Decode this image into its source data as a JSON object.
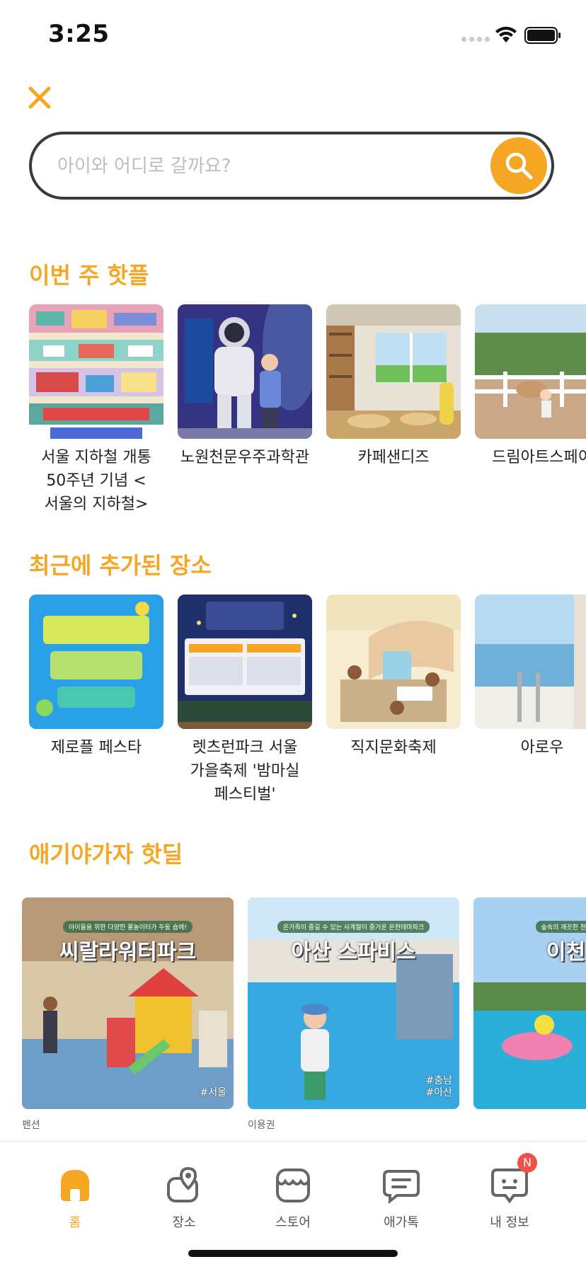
{
  "status_bar": {
    "time": "3:25"
  },
  "search": {
    "placeholder": "아이와 어디로 갈까요?"
  },
  "colors": {
    "accent": "#f5a623",
    "badge": "#f0524a"
  },
  "sections": {
    "hot_places": {
      "title": "이번 주 핫플",
      "items": [
        {
          "name": "서울 지하철 개통 50주년 기념 <서울의 지하철>"
        },
        {
          "name": "노원천문우주과학관"
        },
        {
          "name": "카페샌디즈"
        },
        {
          "name": "드림아트스페이"
        }
      ]
    },
    "recent_places": {
      "title": "최근에 추가된 장소",
      "items": [
        {
          "name": "제로플 페스타"
        },
        {
          "name": "렛츠런파크 서울 가을축제 '밤마실 페스티벌'"
        },
        {
          "name": "직지문화축제"
        },
        {
          "name": "아로우"
        }
      ]
    },
    "hot_deals": {
      "title": "애기야가자 핫딜",
      "items": [
        {
          "headline": "씨랄라워터파크",
          "subline": "아이들을 위한 다양한 물놀이터가 두둥 숍에!",
          "tag": "#서울",
          "type": "펜션"
        },
        {
          "headline": "아산 스파비스",
          "subline": "온가족이 즐길 수 있는 사계절이 즐거운 온천테마파크",
          "tag": "#충남\n#아산",
          "type": "이용권"
        },
        {
          "headline": "이천 테",
          "subline": "숲속의 깨끗한 천연 온천수에",
          "tag": "",
          "type": ""
        }
      ]
    }
  },
  "tab_bar": {
    "home": "홈",
    "places": "장소",
    "store": "스토어",
    "talk": "애가톡",
    "my_info": "내 정보",
    "badge": "N"
  }
}
